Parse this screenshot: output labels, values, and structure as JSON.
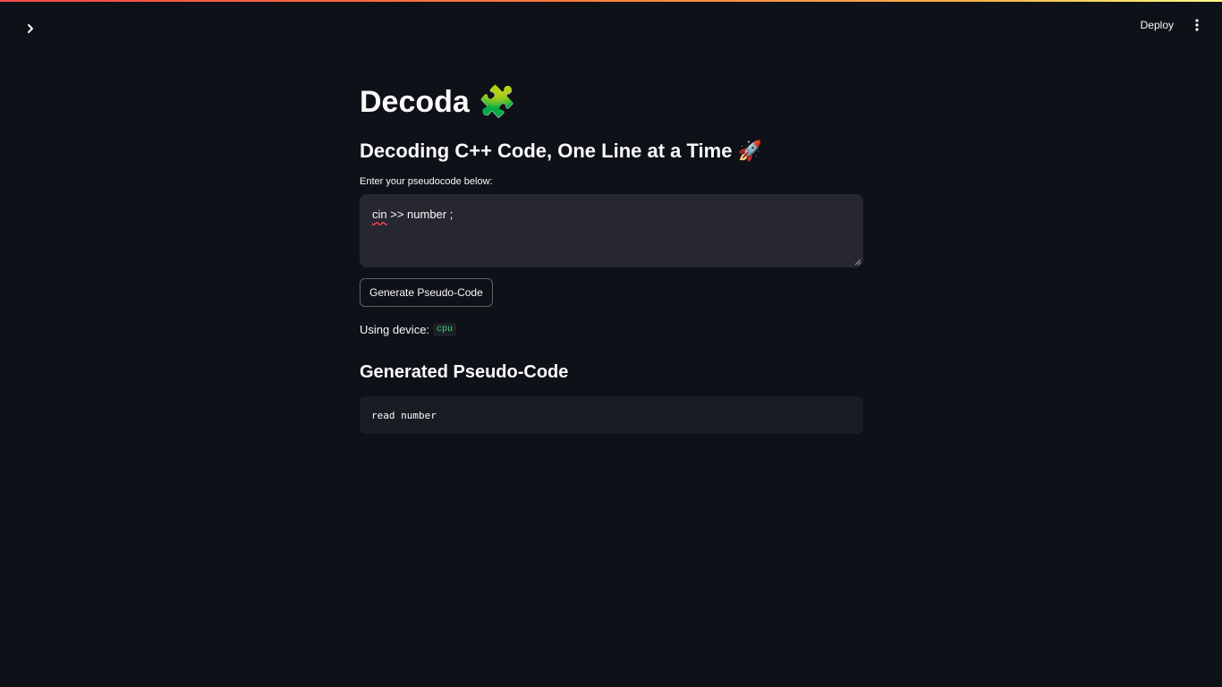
{
  "header": {
    "sidebar_toggle_icon": "chevron-right-icon",
    "deploy_label": "Deploy",
    "menu_icon": "vertical-dots-icon"
  },
  "app": {
    "title": "Decoda",
    "title_emoji": "🧩",
    "subtitle": "Decoding C++ Code, One Line at a Time",
    "subtitle_emoji": "🚀"
  },
  "input": {
    "label": "Enter your pseudocode below:",
    "value_misspelled": "cin",
    "value_rest": " >> number ;"
  },
  "button": {
    "generate_label": "Generate Pseudo-Code"
  },
  "device": {
    "prefix": "Using device:",
    "value": "cpu"
  },
  "output": {
    "heading": "Generated Pseudo-Code",
    "code": "read number"
  },
  "colors": {
    "background": "#0e1117",
    "input_background": "#262730",
    "accent_code": "#3dd56d"
  }
}
